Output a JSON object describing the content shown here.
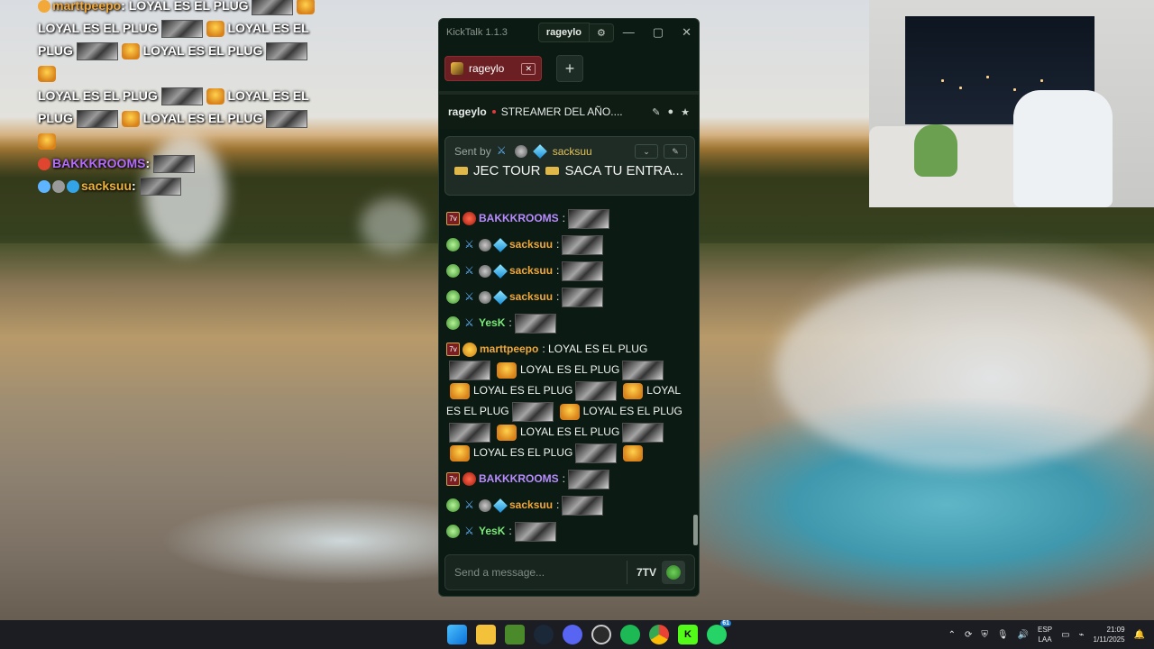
{
  "desktop": {
    "overlay_chat": [
      {
        "badge": "gold",
        "name": "marttpeepo",
        "name_color": "#f3a83a",
        "text": "LOYAL ES EL PLUG"
      },
      {
        "text_lines": [
          "LOYAL ES EL PLUG",
          "LOYAL ES EL",
          "PLUG",
          "LOYAL ES EL PLUG",
          "LOYAL ES EL PLUG",
          "LOYAL ES EL",
          "PLUG",
          "LOYAL ES EL PLUG"
        ]
      },
      {
        "badge": "red",
        "name": "BAKKKROOMS",
        "name_color": "#b46cff"
      },
      {
        "name": "sacksuu",
        "name_color": "#f0b63a"
      }
    ]
  },
  "kicktalk": {
    "app_title": "KickTalk 1.1.3",
    "title_channel": "rageylo",
    "window_controls": [
      "minimize",
      "maximize",
      "close"
    ],
    "tabs": [
      {
        "label": "rageylo"
      }
    ],
    "add_tab_label": "+",
    "header": {
      "channel": "rageylo",
      "stream_title": "STREAMER DEL AÑO...."
    },
    "pinned": {
      "sent_by_label": "Sent by",
      "sender": "sacksuu",
      "message": "JEC TOUR",
      "message2": "SACA TU ENTRA..."
    },
    "messages": [
      {
        "user": "BAKKKROOMS",
        "color": "#b88cff",
        "badges": [
          "7tv",
          "red"
        ],
        "text": ""
      },
      {
        "user": "sacksuu",
        "color": "#f0a83a",
        "badges": [
          "green",
          "sword",
          "gray",
          "cube"
        ],
        "text": ""
      },
      {
        "user": "sacksuu",
        "color": "#f0a83a",
        "badges": [
          "green",
          "sword",
          "gray",
          "cube"
        ],
        "text": ""
      },
      {
        "user": "sacksuu",
        "color": "#f0a83a",
        "badges": [
          "green",
          "sword",
          "gray",
          "cube"
        ],
        "text": ""
      },
      {
        "user": "YesK",
        "color": "#7be87a",
        "badges": [
          "green",
          "sword"
        ],
        "text": ""
      },
      {
        "user": "marttpeepo",
        "color": "#f0a83a",
        "badges": [
          "7tv",
          "gold"
        ],
        "text": "LOYAL ES EL PLUG",
        "continuation": [
          "LOYAL ES EL PLUG",
          "LOYAL ES EL PLUG",
          "LOYAL",
          "ES EL PLUG",
          "LOYAL ES EL PLUG",
          "LOYAL ES EL PLUG",
          "LOYAL ES EL PLUG"
        ]
      },
      {
        "user": "BAKKKROOMS",
        "color": "#b88cff",
        "badges": [
          "7tv",
          "red"
        ],
        "text": ""
      },
      {
        "user": "sacksuu",
        "color": "#f0a83a",
        "badges": [
          "green",
          "sword",
          "gray",
          "cube"
        ],
        "text": ""
      },
      {
        "user": "YesK",
        "color": "#7be87a",
        "badges": [
          "green",
          "sword"
        ],
        "text": ""
      }
    ],
    "input_placeholder": "Send a message...",
    "input_btn_7tv": "7TV"
  },
  "taskbar": {
    "apps": [
      "windows-start",
      "file-explorer",
      "app-green",
      "steam",
      "discord",
      "obs",
      "spotify",
      "chrome",
      "kick",
      "whatsapp"
    ],
    "lang_line1": "ESP",
    "lang_line2": "LAA",
    "time": "21:09",
    "date": "1/11/2025",
    "whatsapp_badge": "61"
  }
}
